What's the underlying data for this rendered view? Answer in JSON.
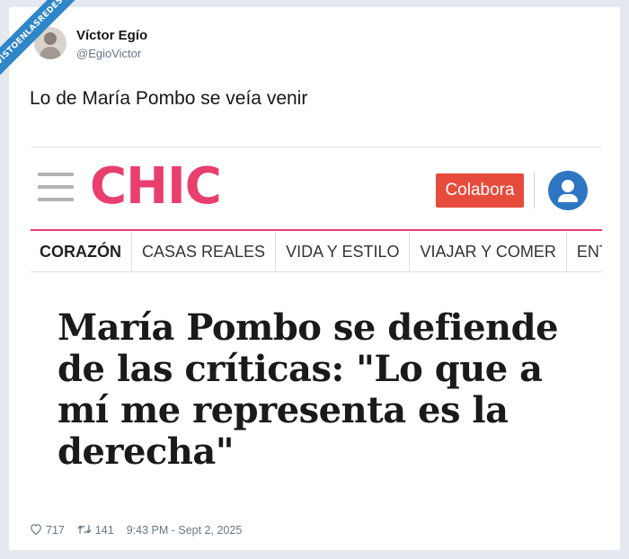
{
  "watermark": "VISTOENLASREDES.COM",
  "tweet": {
    "author_name": "Víctor Egío",
    "author_handle": "@EgioVictor",
    "text": "Lo de María Pombo se veía venir",
    "likes": "717",
    "retweets": "141",
    "timestamp": "9:43 PM - Sept 2, 2025"
  },
  "embedded_site": {
    "logo": "CHIC",
    "cta_label": "Colabora",
    "brand_color": "#e83f6f",
    "cta_color": "#e74b3c",
    "user_icon_color": "#2e75c2",
    "nav": [
      "CORAZÓN",
      "CASAS REALES",
      "VIDA Y ESTILO",
      "VIAJAR Y COMER",
      "ENTRETEN"
    ],
    "headline_lines": [
      "María Pombo se defiende",
      "de las críticas: \"Lo que a",
      "mí me representa es la",
      "derecha\""
    ]
  }
}
